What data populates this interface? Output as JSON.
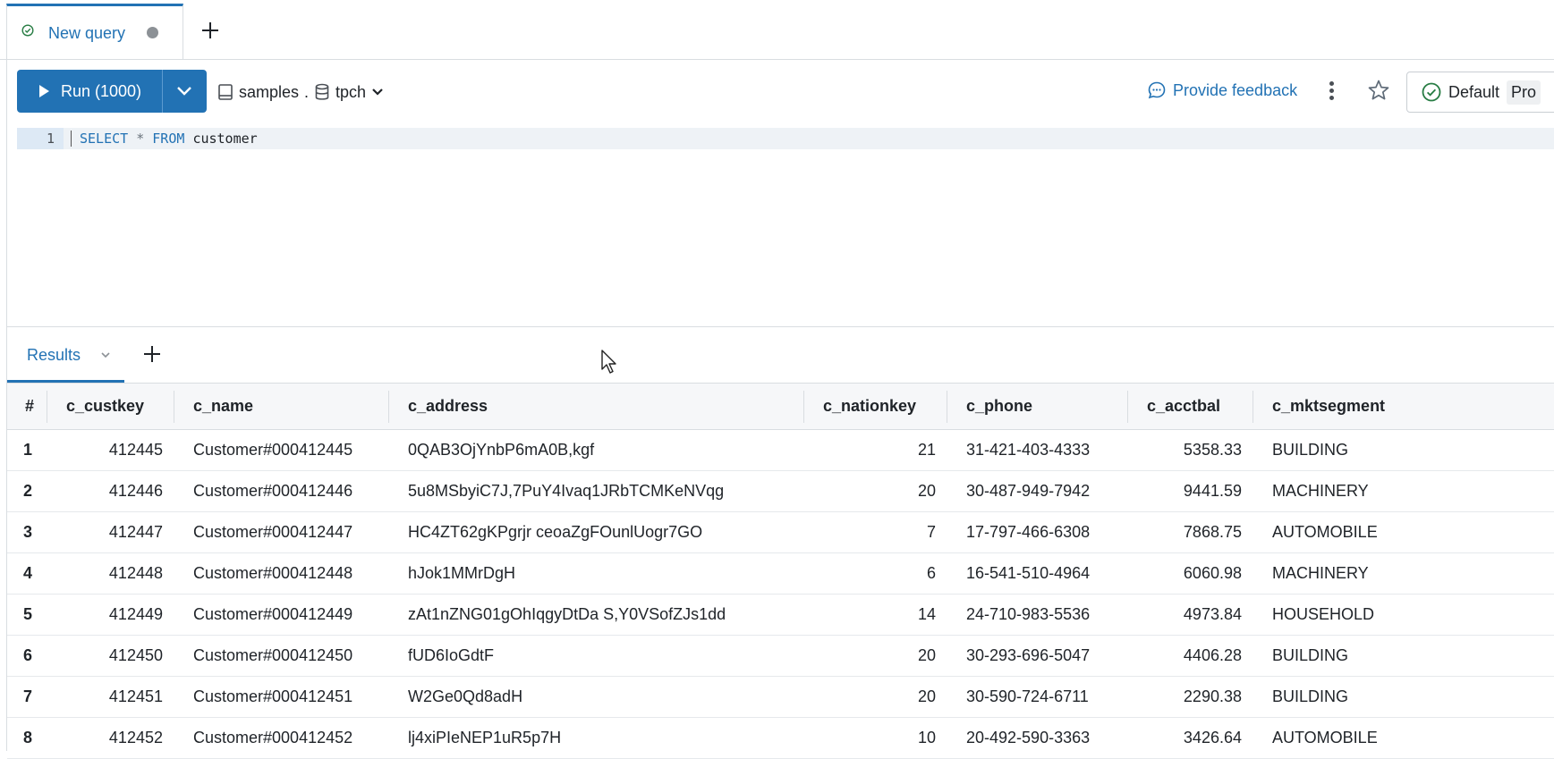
{
  "query_tab": {
    "title": "New query"
  },
  "toolbar": {
    "run_label": "Run (1000)",
    "catalog": "samples",
    "catalog_sep": ".",
    "schema": "tpch",
    "feedback_label": "Provide feedback",
    "compute_label": "Default",
    "compute_badge": "Pro"
  },
  "editor": {
    "line_number": "1",
    "code": {
      "kw1": "SELECT",
      "star": "*",
      "kw2": "FROM",
      "table": "customer"
    }
  },
  "results": {
    "tab_label": "Results"
  },
  "table": {
    "headers": [
      "#",
      "c_custkey",
      "c_name",
      "c_address",
      "c_nationkey",
      "c_phone",
      "c_acctbal",
      "c_mktsegment"
    ],
    "rows": [
      [
        "1",
        "412445",
        "Customer#000412445",
        "0QAB3OjYnbP6mA0B,kgf",
        "21",
        "31-421-403-4333",
        "5358.33",
        "BUILDING"
      ],
      [
        "2",
        "412446",
        "Customer#000412446",
        "5u8MSbyiC7J,7PuY4Ivaq1JRbTCMKeNVqg",
        "20",
        "30-487-949-7942",
        "9441.59",
        "MACHINERY"
      ],
      [
        "3",
        "412447",
        "Customer#000412447",
        "HC4ZT62gKPgrjr ceoaZgFOunlUogr7GO",
        "7",
        "17-797-466-6308",
        "7868.75",
        "AUTOMOBILE"
      ],
      [
        "4",
        "412448",
        "Customer#000412448",
        "hJok1MMrDgH",
        "6",
        "16-541-510-4964",
        "6060.98",
        "MACHINERY"
      ],
      [
        "5",
        "412449",
        "Customer#000412449",
        "zAt1nZNG01gOhIqgyDtDa S,Y0VSofZJs1dd",
        "14",
        "24-710-983-5536",
        "4973.84",
        "HOUSEHOLD"
      ],
      [
        "6",
        "412450",
        "Customer#000412450",
        "fUD6IoGdtF",
        "20",
        "30-293-696-5047",
        "4406.28",
        "BUILDING"
      ],
      [
        "7",
        "412451",
        "Customer#000412451",
        "W2Ge0Qd8adH",
        "20",
        "30-590-724-6711",
        "2290.38",
        "BUILDING"
      ],
      [
        "8",
        "412452",
        "Customer#000412452",
        "lj4xiPIeNEP1uR5p7H",
        "10",
        "20-492-590-3363",
        "3426.64",
        "AUTOMOBILE"
      ]
    ]
  },
  "icons": {
    "query_status": "check-circle-icon",
    "new_tab": "plus-icon",
    "run": "play-icon",
    "run_menu": "chevron-down-icon",
    "catalog": "book-icon",
    "schema": "database-icon",
    "feedback": "chat-bubble-icon",
    "more": "kebab-icon",
    "favorite": "star-icon",
    "compute_status": "check-circle-icon",
    "add_result": "plus-icon",
    "cursor": "mouse-pointer-icon"
  },
  "colors": {
    "accent": "#2272b4",
    "success": "#277c43",
    "header_bg": "#f6f7f9",
    "text": "#1f2328"
  }
}
